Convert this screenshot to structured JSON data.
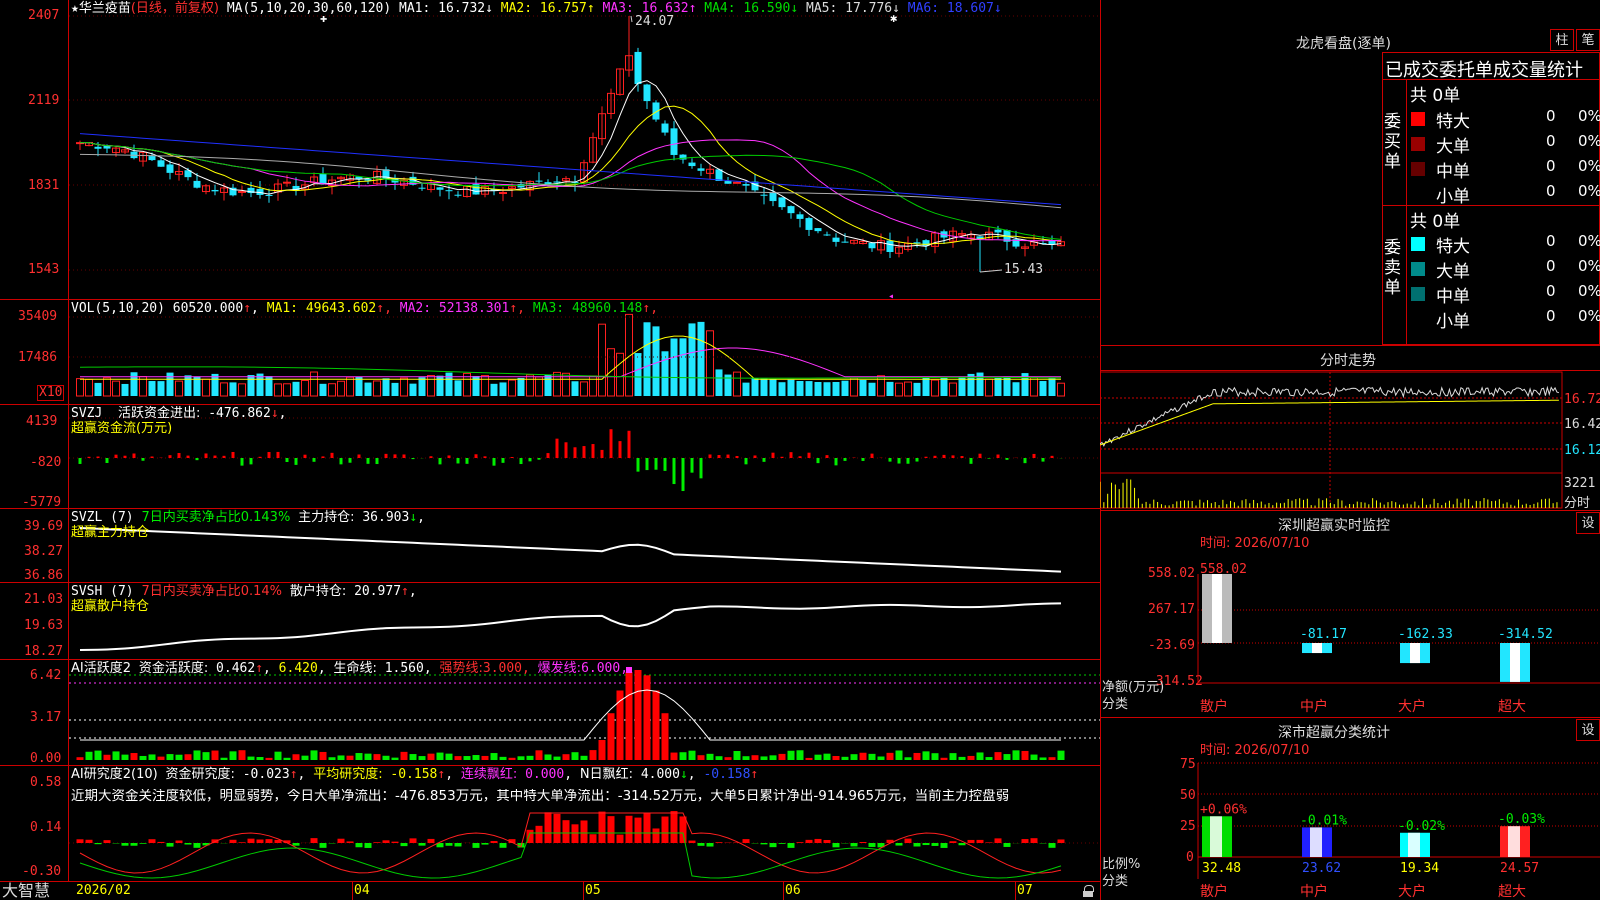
{
  "stock": {
    "name_prefix": "★",
    "name": "华兰疫苗",
    "mode": "(日线，前复权)"
  },
  "colors": {
    "up": "#ff2020",
    "down": "#22e6ff",
    "ma1": "#ffffff",
    "ma2": "#ffff00",
    "ma3": "#ff33ff",
    "ma4": "#00cc00",
    "ma5": "#aaaaaa",
    "ma6": "#2030ff",
    "green": "#00ee00",
    "yellow": "#ffff00",
    "red": "#ff0000",
    "grid": "#cc0000",
    "axis_red": "#ff3030"
  },
  "price_panel": {
    "ma_header": "MA(5,10,20,30,60,120)",
    "ma": [
      {
        "label": "MA1:",
        "value": "16.732",
        "arrow": "↓",
        "color": "#ffffff"
      },
      {
        "label": "MA2:",
        "value": "16.757",
        "arrow": "↑",
        "color": "#ffff00"
      },
      {
        "label": "MA3:",
        "value": "16.632",
        "arrow": "↑",
        "color": "#ff33ff"
      },
      {
        "label": "MA4:",
        "value": "16.590",
        "arrow": "↓",
        "color": "#00dd00"
      },
      {
        "label": "MA5:",
        "value": "17.776",
        "arrow": "↓",
        "color": "#dddddd"
      },
      {
        "label": "MA6:",
        "value": "18.607",
        "arrow": "↓",
        "color": "#3040ff"
      }
    ],
    "y_axis": [
      "2407",
      "2119",
      "1831",
      "1543"
    ],
    "high_label": "24.07",
    "low_label": "15.43"
  },
  "vol_panel": {
    "header": "VOL(5,10,20)",
    "value": "60520.000",
    "arrow": "↑",
    "ma": [
      {
        "label": "MA1:",
        "value": "49643.602",
        "arrow": "↑",
        "color": "#ffff00"
      },
      {
        "label": "MA2:",
        "value": "52138.301",
        "arrow": "↑",
        "color": "#ff33ff"
      },
      {
        "label": "MA3:",
        "value": "48960.148",
        "arrow": "↑",
        "color": "#00dd00"
      }
    ],
    "y_axis": [
      "35409",
      "17486"
    ],
    "unit": "X10"
  },
  "flow_panel": {
    "label1": "SVZJ",
    "label1b": "活跃资金进出:",
    "value1": "-476.862",
    "arrow": "↓",
    "suffix": ",",
    "label2": "超赢资金流(万元)",
    "y_axis": [
      "4139",
      "-820",
      "-5779"
    ]
  },
  "zl_panel": {
    "label1": "SVZL",
    "period": "(7)",
    "label2": "7日内买卖净占比0.143%",
    "label3": "主力持仓:",
    "value": "36.903",
    "arrow": "↓",
    "suffix": ",",
    "label4": "超赢主力持仓",
    "y_axis": [
      "39.69",
      "38.27",
      "36.86"
    ]
  },
  "sh_panel": {
    "label1": "SVSH",
    "period": "(7)",
    "label2": "7日内买卖净占比0.14%",
    "label3": "散户持仓:",
    "value": "20.977",
    "arrow": "↑",
    "suffix": ",",
    "label4": "超赢散户持仓",
    "y_axis": [
      "21.03",
      "19.63",
      "18.27"
    ]
  },
  "ai_active": {
    "label1": "AI活跃度2",
    "label2": "资金活跃度:",
    "v1": "0.462",
    "a1": "↑",
    "v2": "6.420",
    "label3": "生命线:",
    "v3": "1.560",
    "label4": "强势线:",
    "v4": "3.000",
    "label5": "爆发线:",
    "v5": "6.000",
    "end": ",",
    "y_axis": [
      "6.42",
      "3.17",
      "0.00"
    ]
  },
  "ai_research": {
    "label1": "AI研究度2(10)",
    "label2": "资金研究度:",
    "v1": "-0.023",
    "a1": "↑",
    "label3": "平均研究度:",
    "v2": "-0.158",
    "a2": "↑",
    "label4": "连续飘红:",
    "v3": "0.000",
    "label5": "N日飘红:",
    "v4": "4.000",
    "a4": "↓",
    "v5": "-0.158",
    "a5": "↑",
    "comment": "近期大资金关注度较低，明显弱势，今日大单净流出：-476.853万元，其中特大单净流出：-314.52万元，大单5日累计净出-914.965万元，当前主力控盘弱",
    "y_axis": [
      "0.58",
      "0.14",
      "-0.30"
    ]
  },
  "x_axis": {
    "brand": "大智慧",
    "labels": [
      "2026/02",
      "04",
      "05",
      "06",
      "07"
    ]
  },
  "right_panel": {
    "lhb_title": "龙虎看盘(逐单)",
    "btn_zhu": "柱",
    "btn_bi": "笔",
    "order_header": "已成交委托单成交量统计",
    "buy": {
      "side": "委买单",
      "total": "共 0单",
      "rows": [
        {
          "label": "特大",
          "count": "0",
          "pct": "0%",
          "color": "#ff0000"
        },
        {
          "label": "大单",
          "count": "0",
          "pct": "0%",
          "color": "#990000"
        },
        {
          "label": "中单",
          "count": "0",
          "pct": "0%",
          "color": "#660000"
        },
        {
          "label": "小单",
          "count": "0",
          "pct": "0%",
          "color": "#000000"
        }
      ]
    },
    "sell": {
      "side": "委卖单",
      "total": "共 0单",
      "rows": [
        {
          "label": "特大",
          "count": "0",
          "pct": "0%",
          "color": "#00ffff"
        },
        {
          "label": "大单",
          "count": "0",
          "pct": "0%",
          "color": "#008b8b"
        },
        {
          "label": "中单",
          "count": "0",
          "pct": "0%",
          "color": "#007070"
        },
        {
          "label": "小单",
          "count": "0",
          "pct": "0%",
          "color": "#000000"
        }
      ]
    },
    "intraday": {
      "title": "分时走势",
      "y_axis": [
        "16.72",
        "16.42",
        "16.12"
      ],
      "vol": "3221",
      "vol_unit": "分时"
    },
    "monitor": {
      "title": "深圳超赢实时监控",
      "btn": "设",
      "time": "时间: 2026/07/10",
      "y_axis": [
        "558.02",
        "267.17",
        "-23.69",
        "-314.52"
      ],
      "left_label1": "净额(万元)",
      "left_label2": "分类",
      "bars": [
        {
          "cat": "散户",
          "value": 558.02,
          "label": "558.02"
        },
        {
          "cat": "中户",
          "value": -81.17,
          "label": "-81.17"
        },
        {
          "cat": "大户",
          "value": -162.33,
          "label": "-162.33"
        },
        {
          "cat": "超大",
          "value": -314.52,
          "label": "-314.52"
        }
      ]
    },
    "classify": {
      "title": "深市超赢分类统计",
      "btn": "设",
      "time": "时间: 2026/07/10",
      "y_axis": [
        "75",
        "50",
        "25",
        "0"
      ],
      "left_label1": "比例%",
      "left_label2": "分类",
      "bars": [
        {
          "cat": "散户",
          "value": 32.48,
          "label": "32.48",
          "chg": "+0.06%",
          "color": "#00dd00"
        },
        {
          "cat": "中户",
          "value": 23.62,
          "label": "23.62",
          "chg": "-0.01%",
          "color": "#2020ff"
        },
        {
          "cat": "大户",
          "value": 19.34,
          "label": "19.34",
          "chg": "-0.02%",
          "color": "#00ffff"
        },
        {
          "cat": "超大",
          "value": 24.57,
          "label": "24.57",
          "chg": "-0.03%",
          "color": "#ff2020"
        }
      ]
    }
  }
}
